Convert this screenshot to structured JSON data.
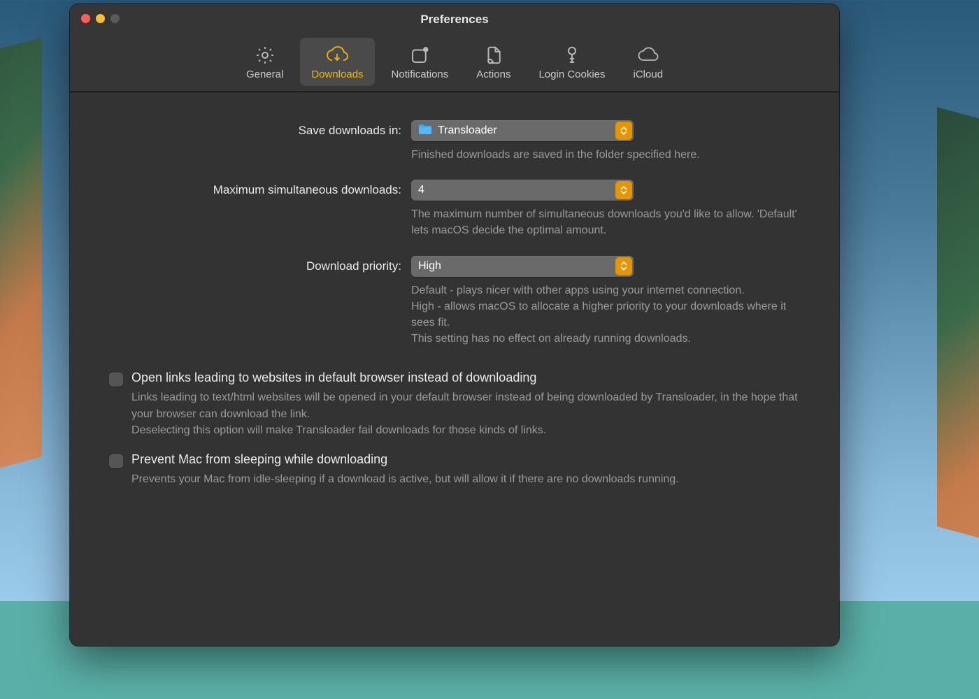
{
  "window": {
    "title": "Preferences"
  },
  "toolbar": {
    "items": [
      {
        "label": "General"
      },
      {
        "label": "Downloads"
      },
      {
        "label": "Notifications"
      },
      {
        "label": "Actions"
      },
      {
        "label": "Login Cookies"
      },
      {
        "label": "iCloud"
      }
    ],
    "active_index": 1
  },
  "fields": {
    "save": {
      "label": "Save downloads in:",
      "value": "Transloader",
      "help": "Finished downloads are saved in the folder specified here."
    },
    "max": {
      "label": "Maximum simultaneous downloads:",
      "value": "4",
      "help": "The maximum number of simultaneous downloads you'd like to allow. 'Default' lets macOS decide the optimal amount."
    },
    "priority": {
      "label": "Download priority:",
      "value": "High",
      "help": "Default - plays nicer with other apps using your internet connection.\nHigh - allows macOS to allocate a higher priority to your downloads where it sees fit.\nThis setting has no effect on already running downloads."
    }
  },
  "checkboxes": {
    "openlinks": {
      "title": "Open links leading to websites in default browser instead of downloading",
      "help": "Links leading to text/html websites will be opened in your default browser instead of being downloaded by Transloader, in the hope that your browser can download the link.\nDeselecting this option will make Transloader fail downloads for those kinds of links.",
      "checked": false
    },
    "preventsleep": {
      "title": "Prevent Mac from sleeping while downloading",
      "help": "Prevents your Mac from idle-sleeping if a download is active, but will allow it if there are no downloads running.",
      "checked": false
    }
  },
  "colors": {
    "accent": "#e59500",
    "active_text": "#f2b705"
  }
}
